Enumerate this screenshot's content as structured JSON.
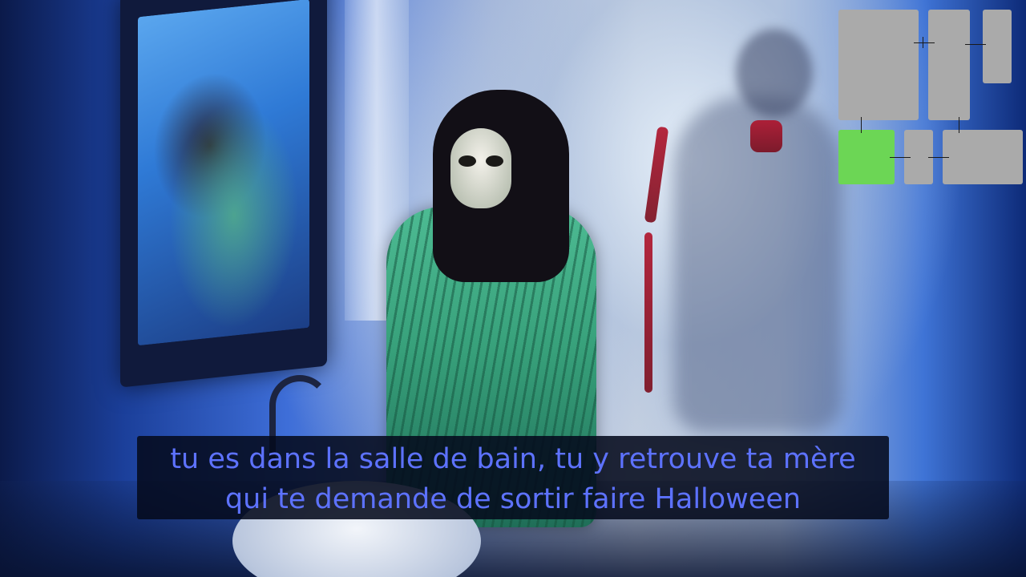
{
  "subtitle": {
    "line1": "tu es dans la salle de bain, tu y retrouve ta mère",
    "line2": "qui te demande de sortir faire Halloween",
    "text_color": "#5d72ff",
    "background_color": "#04101c"
  },
  "minimap": {
    "room_color": "#aaaaaa",
    "current_room_color": "#6cd655",
    "rooms": [
      {
        "name": "room-1",
        "current": false
      },
      {
        "name": "room-2",
        "current": false
      },
      {
        "name": "room-3",
        "current": false
      },
      {
        "name": "room-4",
        "current": true
      },
      {
        "name": "room-5",
        "current": false
      },
      {
        "name": "room-6",
        "current": false
      }
    ]
  }
}
